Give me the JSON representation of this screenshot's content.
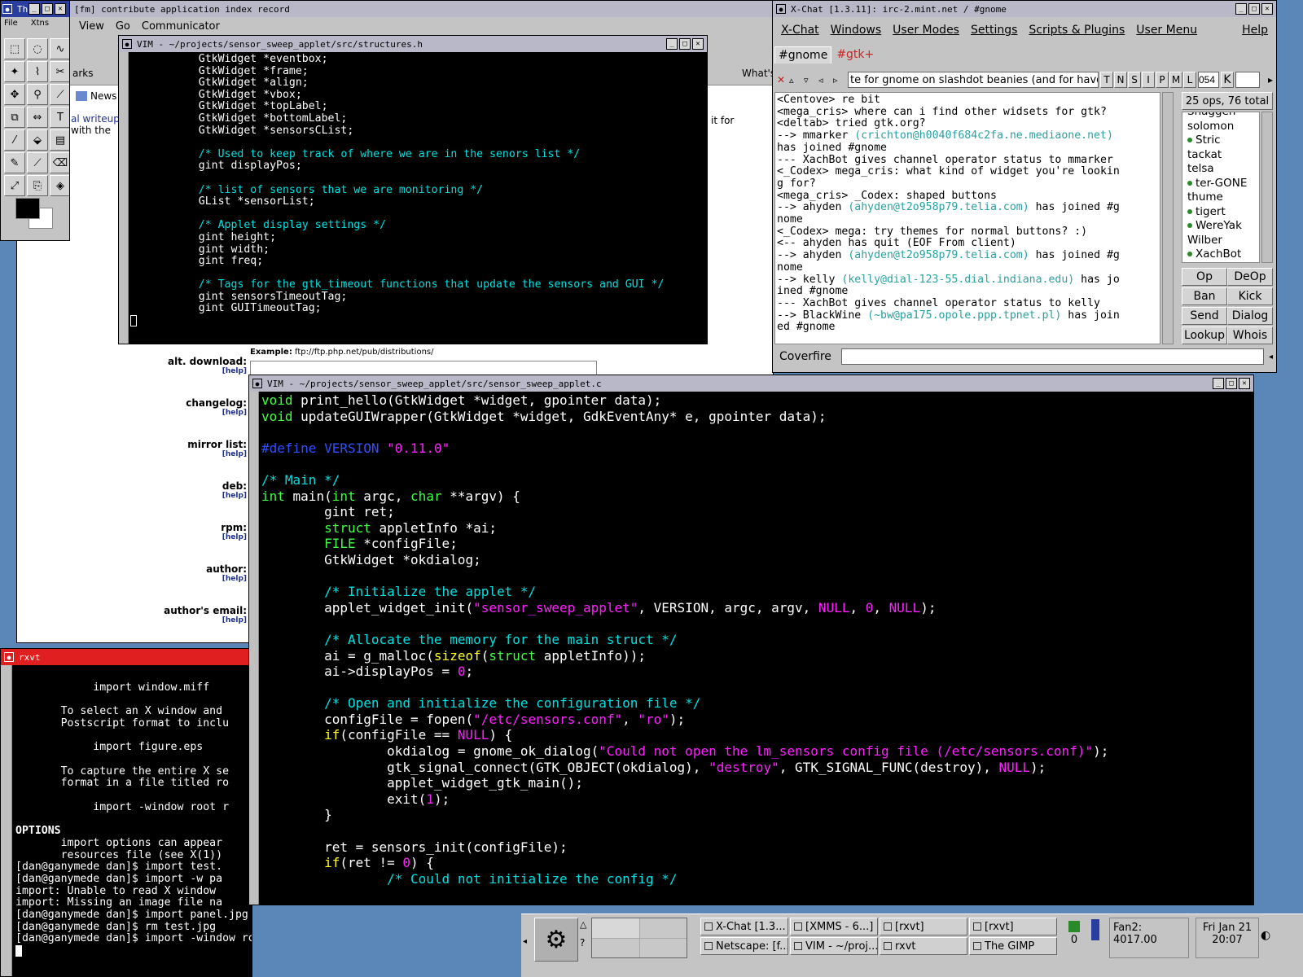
{
  "gimp": {
    "title": "Th",
    "menu": [
      "File",
      "Xtns"
    ]
  },
  "netscape": {
    "title": "[fm] contribute application index record",
    "menu": [
      "View",
      "Go",
      "Communicator"
    ],
    "bookmarks": "arks",
    "news": "News",
    "whats": "What's",
    "writeup_lines": [
      "al writeup",
      "with the"
    ],
    "side_text": "it for",
    "example_label": "Example:",
    "example_value": "ftp://ftp.php.net/pub/distributions/",
    "help": "[help]",
    "fields": [
      "alt. download:",
      "changelog:",
      "mirror list:",
      "deb:",
      "rpm:",
      "author:",
      "author's email:"
    ]
  },
  "vim1": {
    "title": "VIM - ~/projects/sensor_sweep_applet/src/structures.h",
    "lines": [
      {
        "t": "    GtkWidget *eventbox;",
        "c": ""
      },
      {
        "t": "    GtkWidget *frame;",
        "c": ""
      },
      {
        "t": "    GtkWidget *align;",
        "c": ""
      },
      {
        "t": "    GtkWidget *vbox;",
        "c": ""
      },
      {
        "t": "    GtkWidget *topLabel;",
        "c": ""
      },
      {
        "t": "    GtkWidget *bottomLabel;",
        "c": ""
      },
      {
        "t": "    GtkWidget *sensorsCList;",
        "c": ""
      },
      {
        "t": "",
        "c": ""
      },
      {
        "t": "    /* Used to keep track of where we are in the senors list */",
        "c": "c-cmt"
      },
      {
        "t": "    gint displayPos;",
        "c": ""
      },
      {
        "t": "",
        "c": ""
      },
      {
        "t": "    /* list of sensors that we are monitoring */",
        "c": "c-cmt"
      },
      {
        "t": "    GList *sensorList;",
        "c": ""
      },
      {
        "t": "",
        "c": ""
      },
      {
        "t": "    /* Applet display settings */",
        "c": "c-cmt"
      },
      {
        "t": "    gint height;",
        "c": ""
      },
      {
        "t": "    gint width;",
        "c": ""
      },
      {
        "t": "    gint freq;",
        "c": ""
      },
      {
        "t": "",
        "c": ""
      },
      {
        "t": "    /* Tags for the gtk_timeout functions that update the sensors and GUI */",
        "c": "c-cmt"
      },
      {
        "t": "    gint sensorsTimeoutTag;",
        "c": ""
      },
      {
        "t": "    gint GUITimeoutTag;",
        "c": ""
      }
    ]
  },
  "vim2": {
    "title": "VIM - ~/projects/sensor_sweep_applet/src/sensor_sweep_applet.c",
    "lines": [
      [
        [
          "void",
          "c-green"
        ],
        [
          " print_hello(GtkWidget *widget, gpointer data);",
          ""
        ]
      ],
      [
        [
          "void",
          "c-green"
        ],
        [
          " updateGUIWrapper(GtkWidget *widget, GdkEventAny* e, gpointer data);",
          ""
        ]
      ],
      [],
      [
        [
          "#define",
          "c-pp"
        ],
        [
          " ",
          ""
        ],
        [
          "VERSION",
          "c-pp"
        ],
        [
          " ",
          ""
        ],
        [
          "\"0.11.0\"",
          "c-str"
        ]
      ],
      [],
      [
        [
          "/* Main */",
          "c-cmt"
        ]
      ],
      [
        [
          "int",
          "c-green"
        ],
        [
          " main(",
          ""
        ],
        [
          "int",
          "c-green"
        ],
        [
          " argc, ",
          ""
        ],
        [
          "char",
          "c-green"
        ],
        [
          " **argv) {",
          ""
        ]
      ],
      [
        [
          "        gint ret;",
          ""
        ]
      ],
      [
        [
          "        ",
          ""
        ],
        [
          "struct",
          "c-green"
        ],
        [
          " appletInfo *ai;",
          ""
        ]
      ],
      [
        [
          "        ",
          ""
        ],
        [
          "FILE",
          "c-green"
        ],
        [
          " *configFile;",
          ""
        ]
      ],
      [
        [
          "        GtkWidget *okdialog;",
          ""
        ]
      ],
      [],
      [
        [
          "        /* Initialize the applet */",
          "c-cmt"
        ]
      ],
      [
        [
          "        applet_widget_init(",
          ""
        ],
        [
          "\"sensor_sweep_applet\"",
          "c-str"
        ],
        [
          ", VERSION, argc, argv, ",
          ""
        ],
        [
          "NULL",
          "c-str"
        ],
        [
          ", ",
          ""
        ],
        [
          "0",
          "c-num"
        ],
        [
          ", ",
          ""
        ],
        [
          "NULL",
          "c-str"
        ],
        [
          ");",
          ""
        ]
      ],
      [],
      [
        [
          "        /* Allocate the memory for the main struct */",
          "c-cmt"
        ]
      ],
      [
        [
          "        ai = g_malloc(",
          ""
        ],
        [
          "sizeof",
          "c-kw"
        ],
        [
          "(",
          ""
        ],
        [
          "struct",
          "c-green"
        ],
        [
          " appletInfo));",
          ""
        ]
      ],
      [
        [
          "        ai->displayPos = ",
          ""
        ],
        [
          "0",
          "c-num"
        ],
        [
          ";",
          ""
        ]
      ],
      [],
      [
        [
          "        /* Open and initialize the configuration file */",
          "c-cmt"
        ]
      ],
      [
        [
          "        configFile = fopen(",
          ""
        ],
        [
          "\"/etc/sensors.conf\"",
          "c-str"
        ],
        [
          ", ",
          ""
        ],
        [
          "\"ro\"",
          "c-str"
        ],
        [
          ");",
          ""
        ]
      ],
      [
        [
          "        ",
          ""
        ],
        [
          "if",
          "c-kw"
        ],
        [
          "(configFile == ",
          ""
        ],
        [
          "NULL",
          "c-str"
        ],
        [
          ") {",
          ""
        ]
      ],
      [
        [
          "                okdialog = gnome_ok_dialog(",
          ""
        ],
        [
          "\"Could not open the lm_sensors config file (/etc/sensors.conf)\"",
          "c-str"
        ],
        [
          ");",
          ""
        ]
      ],
      [
        [
          "                gtk_signal_connect(GTK_OBJECT(okdialog), ",
          ""
        ],
        [
          "\"destroy\"",
          "c-str"
        ],
        [
          ", GTK_SIGNAL_FUNC(destroy), ",
          ""
        ],
        [
          "NULL",
          "c-str"
        ],
        [
          ");",
          ""
        ]
      ],
      [
        [
          "                applet_widget_gtk_main();",
          ""
        ]
      ],
      [
        [
          "                exit(",
          ""
        ],
        [
          "1",
          "c-num"
        ],
        [
          ");",
          ""
        ]
      ],
      [
        [
          "        }",
          ""
        ]
      ],
      [],
      [
        [
          "        ret = sensors_init(configFile);",
          ""
        ]
      ],
      [
        [
          "        ",
          ""
        ],
        [
          "if",
          "c-kw"
        ],
        [
          "(ret != ",
          ""
        ],
        [
          "0",
          "c-num"
        ],
        [
          ") {",
          ""
        ]
      ],
      [
        [
          "                /* Could not initialize the config */",
          "c-cmt"
        ]
      ]
    ]
  },
  "rxvt": {
    "title": "rxvt",
    "lines": [
      {
        "t": "",
        "b": false
      },
      {
        "t": "            import window.miff",
        "b": false
      },
      {
        "t": "",
        "b": false
      },
      {
        "t": "       To select an X window and",
        "b": false
      },
      {
        "t": "       Postscript format to inclu",
        "b": false
      },
      {
        "t": "",
        "b": false
      },
      {
        "t": "            import figure.eps",
        "b": false
      },
      {
        "t": "",
        "b": false
      },
      {
        "t": "       To capture the entire X se",
        "b": false
      },
      {
        "t": "       format in a file titled ro",
        "b": false
      },
      {
        "t": "",
        "b": false
      },
      {
        "t": "            import -window root r",
        "b": false
      },
      {
        "t": "",
        "b": false
      },
      {
        "t": "OPTIONS",
        "b": true
      },
      {
        "t": "       import options can appear",
        "b": false
      },
      {
        "t": "       resources file (see X(1))",
        "b": false
      },
      {
        "t": "[dan@ganymede dan]$ import test.",
        "b": false
      },
      {
        "t": "[dan@ganymede dan]$ import -w pa",
        "b": false
      },
      {
        "t": "import: Unable to read X window",
        "b": false
      },
      {
        "t": "import: Missing an image file na",
        "b": false
      },
      {
        "t": "[dan@ganymede dan]$ import panel.jpg",
        "b": false
      },
      {
        "t": "[dan@ganymede dan]$ rm test.jpg",
        "b": false
      },
      {
        "t": "[dan@ganymede dan]$ import -window root root.jpg",
        "b": false
      }
    ]
  },
  "xchat": {
    "title": "X-Chat [1.3.11]: irc-2.mint.net / #gnome",
    "menu": [
      "X-Chat",
      "Windows",
      "User Modes",
      "Settings",
      "Scripts & Plugins",
      "User Menu"
    ],
    "help": "Help",
    "tabs": [
      "#gnome",
      "#gtk+"
    ],
    "topic": "te for gnome on slashdot beanies (and for havoc)",
    "mode_buttons": [
      "T",
      "N",
      "S",
      "I",
      "P",
      "M",
      "L"
    ],
    "limit_value": "054",
    "key_label": "K",
    "ops_total": "25 ops, 76 total",
    "nicks": [
      {
        "n": "Snaggen",
        "op": false
      },
      {
        "n": "solomon",
        "op": false
      },
      {
        "n": "Stric",
        "op": true
      },
      {
        "n": "tackat",
        "op": false
      },
      {
        "n": "telsa",
        "op": false
      },
      {
        "n": "ter-GONE",
        "op": true
      },
      {
        "n": "thume",
        "op": false
      },
      {
        "n": "tigert",
        "op": true
      },
      {
        "n": "WereYak",
        "op": true
      },
      {
        "n": "Wilber",
        "op": false
      },
      {
        "n": "XachBot",
        "op": true
      }
    ],
    "actions": [
      "Op",
      "DeOp",
      "Ban",
      "Kick",
      "Send",
      "Dialog",
      "Lookup",
      "Whois"
    ],
    "lines": [
      [
        [
          "<Centove>",
          "#000"
        ],
        [
          " re bit",
          "#000"
        ]
      ],
      [
        [
          "<mega_cris>",
          "#000"
        ],
        [
          " where can i find other widsets for gtk?",
          "#000"
        ]
      ],
      [
        [
          "<deltab>",
          "#000"
        ],
        [
          " tried gtk.org?",
          "#000"
        ]
      ],
      [
        [
          "-->",
          "#000"
        ],
        [
          " mmarker ",
          "#000"
        ],
        [
          "(crichton@h0040f684c2fa.ne.mediaone.net)",
          "#2aa0a0"
        ]
      ],
      [
        [
          "has joined #gnome",
          "#000"
        ]
      ],
      [
        [
          "---",
          "#000"
        ],
        [
          " XachBot gives channel operator status to mmarker",
          "#000"
        ]
      ],
      [
        [
          "<_Codex>",
          "#000"
        ],
        [
          " mega_cris: what kind of widget you're lookin",
          "#000"
        ]
      ],
      [
        [
          "g for?",
          "#000"
        ]
      ],
      [
        [
          "<mega_cris>",
          "#000"
        ],
        [
          " _Codex: shaped buttons",
          "#000"
        ]
      ],
      [
        [
          "-->",
          "#000"
        ],
        [
          " ahyden ",
          "#000"
        ],
        [
          "(ahyden@t2o958p79.telia.com)",
          "#2aa0a0"
        ],
        [
          " has joined #g",
          "#000"
        ]
      ],
      [
        [
          "nome",
          "#000"
        ]
      ],
      [
        [
          "<_Codex>",
          "#000"
        ],
        [
          " mega: try themes for normal buttons? :)",
          "#000"
        ]
      ],
      [
        [
          "<--",
          "#000"
        ],
        [
          " ahyden has quit (EOF From client)",
          "#000"
        ]
      ],
      [
        [
          "-->",
          "#000"
        ],
        [
          " ahyden ",
          "#000"
        ],
        [
          "(ahyden@t2o958p79.telia.com)",
          "#2aa0a0"
        ],
        [
          " has joined #g",
          "#000"
        ]
      ],
      [
        [
          "nome",
          "#000"
        ]
      ],
      [
        [
          "-->",
          "#000"
        ],
        [
          " kelly ",
          "#000"
        ],
        [
          "(kelly@dial-123-55.dial.indiana.edu)",
          "#2aa0a0"
        ],
        [
          " has jo",
          "#000"
        ]
      ],
      [
        [
          "ined #gnome",
          "#000"
        ]
      ],
      [
        [
          "---",
          "#000"
        ],
        [
          " XachBot gives channel operator status to kelly",
          "#000"
        ]
      ],
      [
        [
          "-->",
          "#000"
        ],
        [
          " BlackWine ",
          "#000"
        ],
        [
          "(~bw@pa175.opole.ppp.tpnet.pl)",
          "#2aa0a0"
        ],
        [
          " has join",
          "#000"
        ]
      ],
      [
        [
          "ed #gnome",
          "#000"
        ]
      ]
    ],
    "nick": "Coverfire"
  },
  "taskbar": {
    "tasks": [
      "X-Chat [1.3...",
      "[XMMS - 6...]",
      "[rxvt]",
      "[rxvt]",
      "Netscape: [f...",
      "VIM - ~/proj...",
      "rxvt",
      "The GIMP"
    ],
    "mail_count": "0",
    "fan": "Fan2: 4017.00",
    "date": "Fri Jan 21",
    "time": "20:07"
  }
}
